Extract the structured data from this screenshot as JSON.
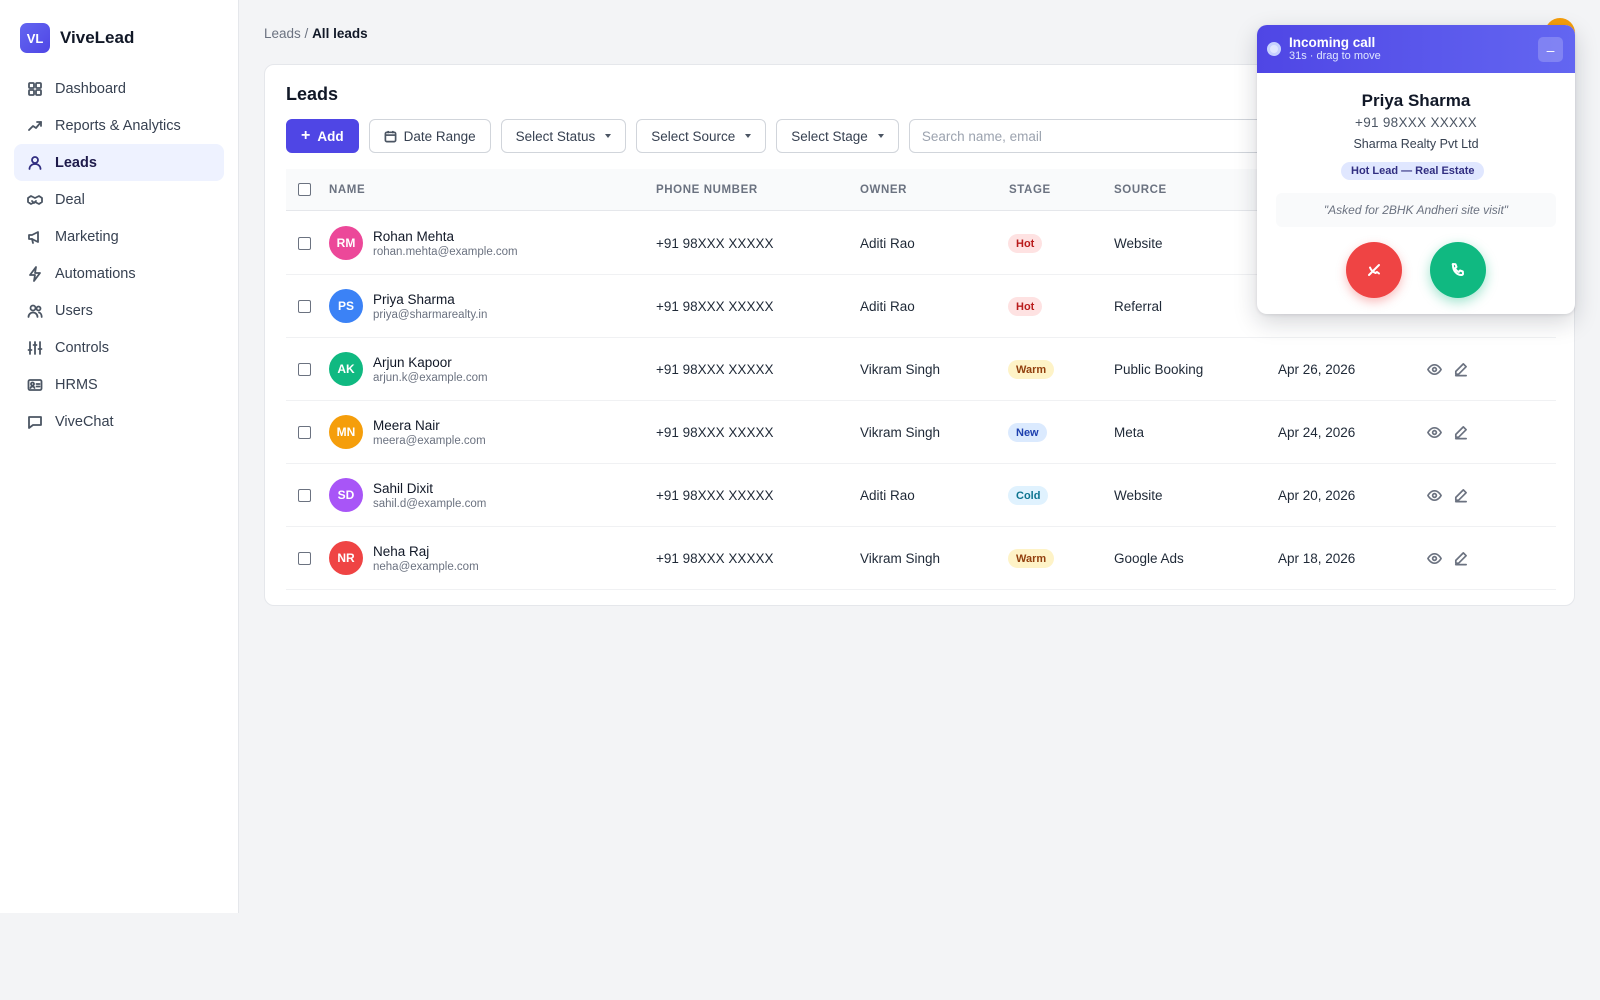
{
  "brand": {
    "logo_text": "VL",
    "name": "ViveLead",
    "logo_color": "#4f46e5"
  },
  "sidebar": {
    "items": [
      {
        "label": "Dashboard",
        "icon": "grid-icon"
      },
      {
        "label": "Reports & Analytics",
        "icon": "trending-up-icon"
      },
      {
        "label": "Leads",
        "icon": "user-icon",
        "active": true
      },
      {
        "label": "Deal",
        "icon": "handshake-icon"
      },
      {
        "label": "Marketing",
        "icon": "megaphone-icon"
      },
      {
        "label": "Automations",
        "icon": "lightning-icon"
      },
      {
        "label": "Users",
        "icon": "users-icon"
      },
      {
        "label": "Controls",
        "icon": "sliders-icon"
      },
      {
        "label": "HRMS",
        "icon": "id-card-icon"
      },
      {
        "label": "ViveChat",
        "icon": "chat-icon"
      }
    ]
  },
  "breadcrumb": {
    "parent": "Leads",
    "separator": " / ",
    "current": "All leads"
  },
  "page": {
    "title": "Leads"
  },
  "toolbar": {
    "add_label": "Add",
    "date_range_label": "Date Range",
    "status_label": "Select Status",
    "source_label": "Select Source",
    "stage_label": "Select Stage",
    "search_placeholder": "Search name, email"
  },
  "table": {
    "columns": [
      "NAME",
      "PHONE NUMBER",
      "OWNER",
      "STAGE",
      "SOURCE"
    ],
    "rows": [
      {
        "initials": "RM",
        "name": "Rohan Mehta",
        "email": "rohan.mehta@example.com",
        "phone": "+91 98XXX XXXXX",
        "owner": "Aditi Rao",
        "stage": "Hot",
        "source": "Website",
        "date": ""
      },
      {
        "initials": "PS",
        "name": "Priya Sharma",
        "email": "priya@sharmarealty.in",
        "phone": "+91 98XXX XXXXX",
        "owner": "Aditi Rao",
        "stage": "Hot",
        "source": "Referral",
        "date": ""
      },
      {
        "initials": "AK",
        "name": "Arjun Kapoor",
        "email": "arjun.k@example.com",
        "phone": "+91 98XXX XXXXX",
        "owner": "Vikram Singh",
        "stage": "Warm",
        "source": "Public Booking",
        "date": "Apr 26, 2026"
      },
      {
        "initials": "MN",
        "name": "Meera Nair",
        "email": "meera@example.com",
        "phone": "+91 98XXX XXXXX",
        "owner": "Vikram Singh",
        "stage": "New",
        "source": "Meta",
        "date": "Apr 24, 2026"
      },
      {
        "initials": "SD",
        "name": "Sahil Dixit",
        "email": "sahil.d@example.com",
        "phone": "+91 98XXX XXXXX",
        "owner": "Aditi Rao",
        "stage": "Cold",
        "source": "Website",
        "date": "Apr 20, 2026"
      },
      {
        "initials": "NR",
        "name": "Neha Raj",
        "email": "neha@example.com",
        "phone": "+91 98XXX XXXXX",
        "owner": "Vikram Singh",
        "stage": "Warm",
        "source": "Google Ads",
        "date": "Apr 18, 2026"
      }
    ]
  },
  "avatar_colors": [
    "#ec4899",
    "#3b82f6",
    "#10b981",
    "#f59e0b",
    "#a855f7",
    "#ef4444"
  ],
  "stage_colors": {
    "Hot": {
      "bg": "#fee2e2",
      "fg": "#b91c1c"
    },
    "Warm": {
      "bg": "#fef3c7",
      "fg": "#92400e"
    },
    "New": {
      "bg": "#dbeafe",
      "fg": "#1e40af"
    },
    "Cold": {
      "bg": "#e0f2fe",
      "fg": "#0e7490"
    }
  },
  "call": {
    "title": "Incoming call",
    "subtitle": "31s · drag to move",
    "minimize_label": "–",
    "caller_name": "Priya Sharma",
    "caller_phone": "+91 98XXX XXXXX",
    "company": "Sharma Realty Pvt Ltd",
    "tag": "Hot Lead — Real Estate",
    "note": "\"Asked for 2BHK Andheri site visit\"",
    "decline_icon": "phone-off-icon",
    "accept_icon": "phone-icon"
  }
}
